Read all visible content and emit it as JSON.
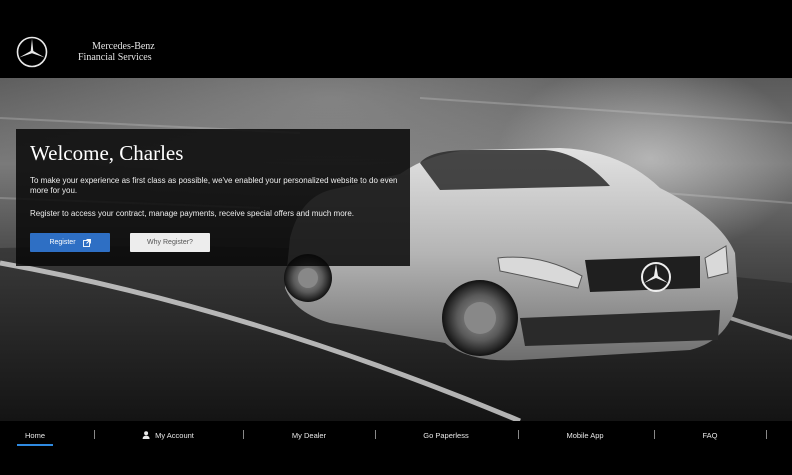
{
  "header": {
    "brand_line1": "Mercedes-Benz",
    "brand_line2": "Financial Services",
    "logo_icon": "mercedes-star-icon"
  },
  "welcome": {
    "title": "Welcome, Charles",
    "paragraph1": "To make your experience as first class as possible, we've enabled your personalized website to do even more for you.",
    "paragraph2": "Register to access your contract, manage payments, receive special offers and much more.",
    "register_label": "Register",
    "register_icon": "external-link-icon",
    "why_register_label": "Why Register?"
  },
  "nav": {
    "items": [
      {
        "label": "Home",
        "active": true
      },
      {
        "label": "My Account",
        "icon": "person-icon"
      },
      {
        "label": "My Dealer"
      },
      {
        "label": "Go Paperless"
      },
      {
        "label": "Mobile App"
      },
      {
        "label": "FAQ"
      }
    ],
    "active_color": "#2f8ae0"
  },
  "colors": {
    "register_button": "#2e6fc4",
    "background": "#000000"
  }
}
